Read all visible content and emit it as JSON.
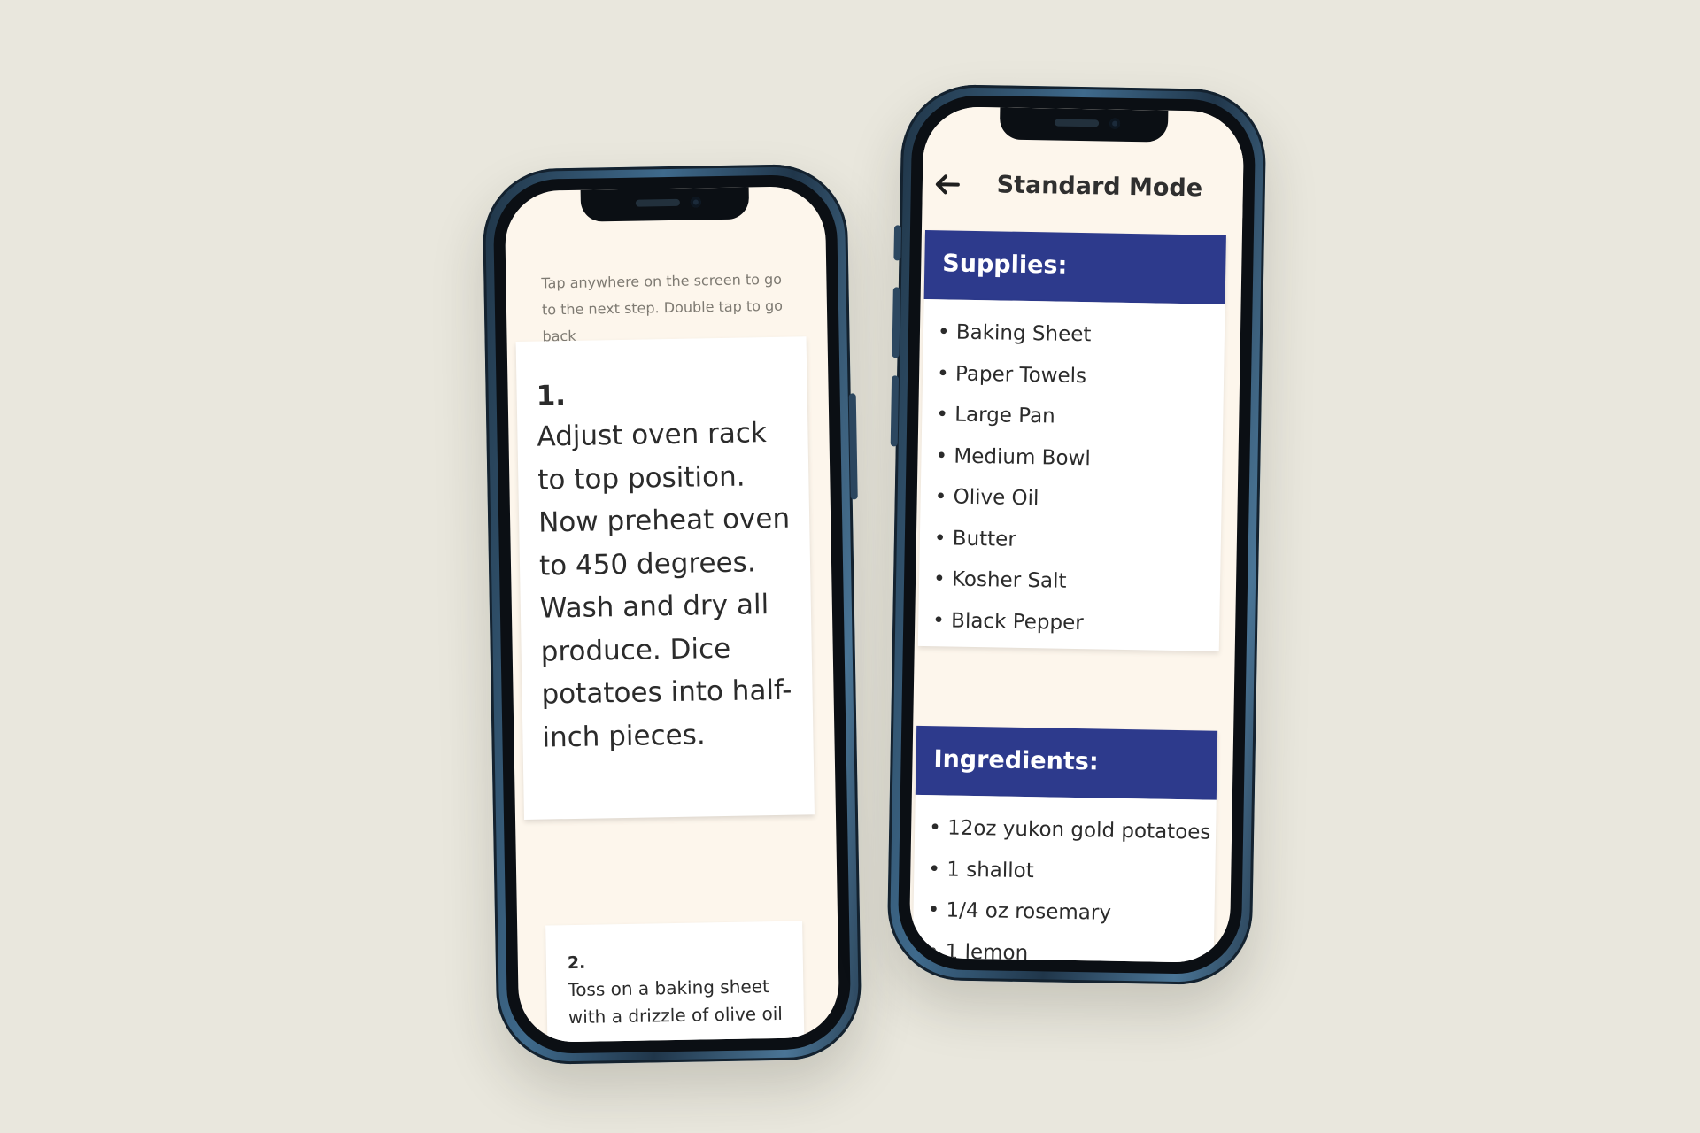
{
  "left_screen": {
    "hint": "Tap anywhere on the screen to go to the next step. Double tap to go back",
    "step1": {
      "number": "1.",
      "text": "Adjust oven rack to top position. Now preheat oven to 450 degrees. Wash and dry all produce. Dice potatoes into half-inch pieces."
    },
    "step2": {
      "number": "2.",
      "text": "Toss on a baking sheet with a drizzle of olive oil"
    }
  },
  "right_screen": {
    "title": "Standard Mode",
    "back_icon": "arrow-left-icon",
    "supplies": {
      "header": "Supplies:",
      "items": [
        "Baking Sheet",
        "Paper Towels",
        "Large Pan",
        "Medium Bowl",
        "Olive Oil",
        "Butter",
        "Kosher Salt",
        "Black Pepper"
      ]
    },
    "ingredients": {
      "header": "Ingredients:",
      "items": [
        "12oz yukon gold potatoes",
        "1 shallot",
        "1/4 oz rosemary",
        "1 lemon"
      ]
    }
  },
  "colors": {
    "background": "#e9e7dd",
    "screen_bg": "#fdf6ec",
    "section_header": "#2d3a8c",
    "phone_frame": "#3f6a8c"
  }
}
